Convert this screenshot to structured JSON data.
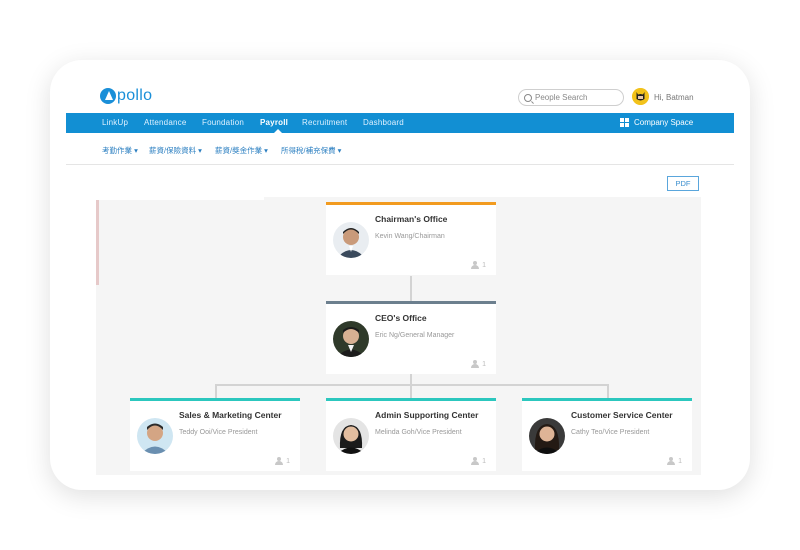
{
  "app": {
    "logo_text": "pollo"
  },
  "header": {
    "search_placeholder": "People Search",
    "greeting": "Hi, Batman"
  },
  "nav": {
    "items": [
      "LinkUp",
      "Attendance",
      "Foundation",
      "Payroll",
      "Recruitment",
      "Dashboard"
    ],
    "active": "Payroll",
    "company_space": "Company Space",
    "color": "#128fd3"
  },
  "subnav": {
    "items": [
      "考勤作業 ▾",
      "薪資/保險資料 ▾",
      "薪資/獎金作業 ▾",
      "所得稅/補充保費 ▾"
    ]
  },
  "toolbar": {
    "pdf_label": "PDF"
  },
  "org_chart": {
    "root": {
      "title": "Chairman's Office",
      "subtitle": "Kevin Wang/Chairman",
      "count": "1",
      "accent": "#f29b1f"
    },
    "second": {
      "title": "CEO's Office",
      "subtitle": "Eric Ng/General Manager",
      "count": "1",
      "accent": "#6c7f8e"
    },
    "children": [
      {
        "title": "Sales & Marketing Center",
        "subtitle": "Teddy Ooi/Vice President",
        "count": "1",
        "accent": "#2cc7be"
      },
      {
        "title": "Admin Supporting Center",
        "subtitle": "Melinda Goh/Vice President",
        "count": "1",
        "accent": "#2cc7be"
      },
      {
        "title": "Customer Service Center",
        "subtitle": "Cathy Teo/Vice President",
        "count": "1",
        "accent": "#2cc7be"
      }
    ]
  }
}
